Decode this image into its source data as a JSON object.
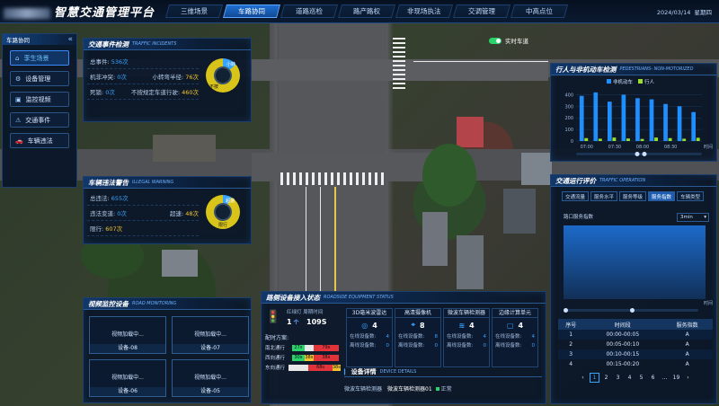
{
  "header": {
    "title": "智慧交通管理平台",
    "nav": [
      "三维场景",
      "车路协同",
      "道路巡检",
      "路产路权",
      "非现场执法",
      "交调管理",
      "中高点位"
    ],
    "active_nav": 1,
    "date": "2024/03/14",
    "weekday": "星期四"
  },
  "sidebar": {
    "title": "车路协同",
    "collapse_icon": "double-chevron-left",
    "items": [
      {
        "label": "孪生场景",
        "icon": "home-icon"
      },
      {
        "label": "设备管理",
        "icon": "gear-icon"
      },
      {
        "label": "监控视频",
        "icon": "camera-icon"
      },
      {
        "label": "交通事件",
        "icon": "event-icon"
      },
      {
        "label": "车辆违法",
        "icon": "car-icon"
      }
    ],
    "active": 0
  },
  "incidents": {
    "title": "交通事件检测",
    "title_en": "TRAFFIC INCIDENTS",
    "rows": [
      [
        {
          "label": "总事件:",
          "value": "536次"
        }
      ],
      [
        {
          "label": "机非冲突:",
          "value": "0次"
        },
        {
          "label": "小转弯半径:",
          "value": "76次"
        }
      ],
      [
        {
          "label": "死锁:",
          "value": "0次"
        },
        {
          "label": "不按规定车道行驶:",
          "value": "460次"
        }
      ]
    ],
    "gauge": {
      "labels": [
        "小转",
        "不按"
      ]
    }
  },
  "violations": {
    "title": "车辆违法警告",
    "title_en": "ILLEGAL WARNING",
    "rows": [
      [
        {
          "label": "总违法:",
          "value": "655次"
        }
      ],
      [
        {
          "label": "违法变道:",
          "value": "0次"
        },
        {
          "label": "超速:",
          "value": "48次"
        }
      ],
      [
        {
          "label": "限行:",
          "value": "607次"
        }
      ]
    ],
    "gauge": {
      "labels": [
        "超速",
        "限行"
      ]
    }
  },
  "monitoring": {
    "title": "视频监控设备",
    "title_en": "ROAD MONITORING",
    "cameras": [
      {
        "status": "视频加载中...",
        "name": "设备-08"
      },
      {
        "status": "视频加载中...",
        "name": "设备-07"
      },
      {
        "status": "视频加载中...",
        "name": "设备-06"
      },
      {
        "status": "视频加载中...",
        "name": "设备-05"
      }
    ]
  },
  "roadside": {
    "title": "路侧设备接入状态",
    "title_en": "ROADSIDE EQUIPMENT STATUS",
    "signal": {
      "label_light": "红绿灯",
      "label_cycle": "周期时间",
      "light_count": "1",
      "cycle": "109S"
    },
    "plan_title": "配时方案:",
    "plans": [
      {
        "dir": "南北通行",
        "green": "27s",
        "yellow": "",
        "red": "79s"
      },
      {
        "dir": "西向通行",
        "green": "30s",
        "yellow": "38s",
        "red": "38s"
      },
      {
        "dir": "东向通行",
        "green": "",
        "yellow": "",
        "red": "68s",
        "red2": "38s"
      }
    ],
    "devices": [
      {
        "name": "3D毫米波雷达",
        "count": "4",
        "online_label": "在线设备数:",
        "online": "4",
        "offline_label": "离线设备数:",
        "offline": "0"
      },
      {
        "name": "高清摄像机",
        "count": "8",
        "online_label": "在线设备数:",
        "online": "8",
        "offline_label": "离线设备数:",
        "offline": "0"
      },
      {
        "name": "微波车辆检测器",
        "count": "4",
        "online_label": "在线设备数:",
        "online": "4",
        "offline_label": "离线设备数:",
        "offline": "0"
      },
      {
        "name": "边缘计算单元",
        "count": "4",
        "online_label": "在线设备数:",
        "online": "4",
        "offline_label": "离线设备数:",
        "offline": "0"
      }
    ],
    "detail": {
      "title": "设备详情",
      "title_en": "DEVICE DETAILS",
      "category": "微波车辆检测器",
      "device": "微波车辆检测器01",
      "status": "正常"
    }
  },
  "map": {
    "realtime_label": "实时车道"
  },
  "pedestrian": {
    "title": "行人与非机动车检测",
    "title_en": "PEDESTRIANS- NON-MOTORIZED",
    "legend": [
      "非机动车",
      "行人"
    ],
    "xlabel": "时间",
    "colors": {
      "motor": "#1f8fff",
      "ped": "#9adf2c"
    }
  },
  "chart_data": {
    "type": "bar",
    "categories": [
      "07:00",
      "07:30",
      "08:00",
      "08:30"
    ],
    "series": [
      {
        "name": "非机动车",
        "values": [
          390,
          420,
          340,
          400,
          370,
          360,
          320,
          300,
          250
        ]
      },
      {
        "name": "行人",
        "values": [
          25,
          20,
          30,
          22,
          18,
          30,
          25,
          20,
          28
        ]
      }
    ],
    "yticks": [
      400,
      300,
      200,
      100,
      0
    ],
    "ylim": [
      0,
      450
    ]
  },
  "operation": {
    "title": "交通运行评价",
    "title_en": "TRAFFIC OPERATION",
    "tabs": [
      "交通流量",
      "服务水平",
      "服务等级",
      "服务指数",
      "车辆类型"
    ],
    "active_tab": 3,
    "subtitle": "路口服务指数",
    "select": "3min",
    "xlabel": "时间",
    "table": {
      "headers": [
        "序号",
        "时间段",
        "服务指数"
      ],
      "rows": [
        [
          "1",
          "00:00-00:05",
          "A"
        ],
        [
          "2",
          "00:05-00:10",
          "A"
        ],
        [
          "3",
          "00:10-00:15",
          "A"
        ],
        [
          "4",
          "00:15-00:20",
          "A"
        ]
      ]
    },
    "pages": [
      "1",
      "2",
      "3",
      "4",
      "5",
      "6",
      "...",
      "19"
    ],
    "active_page": 0
  }
}
